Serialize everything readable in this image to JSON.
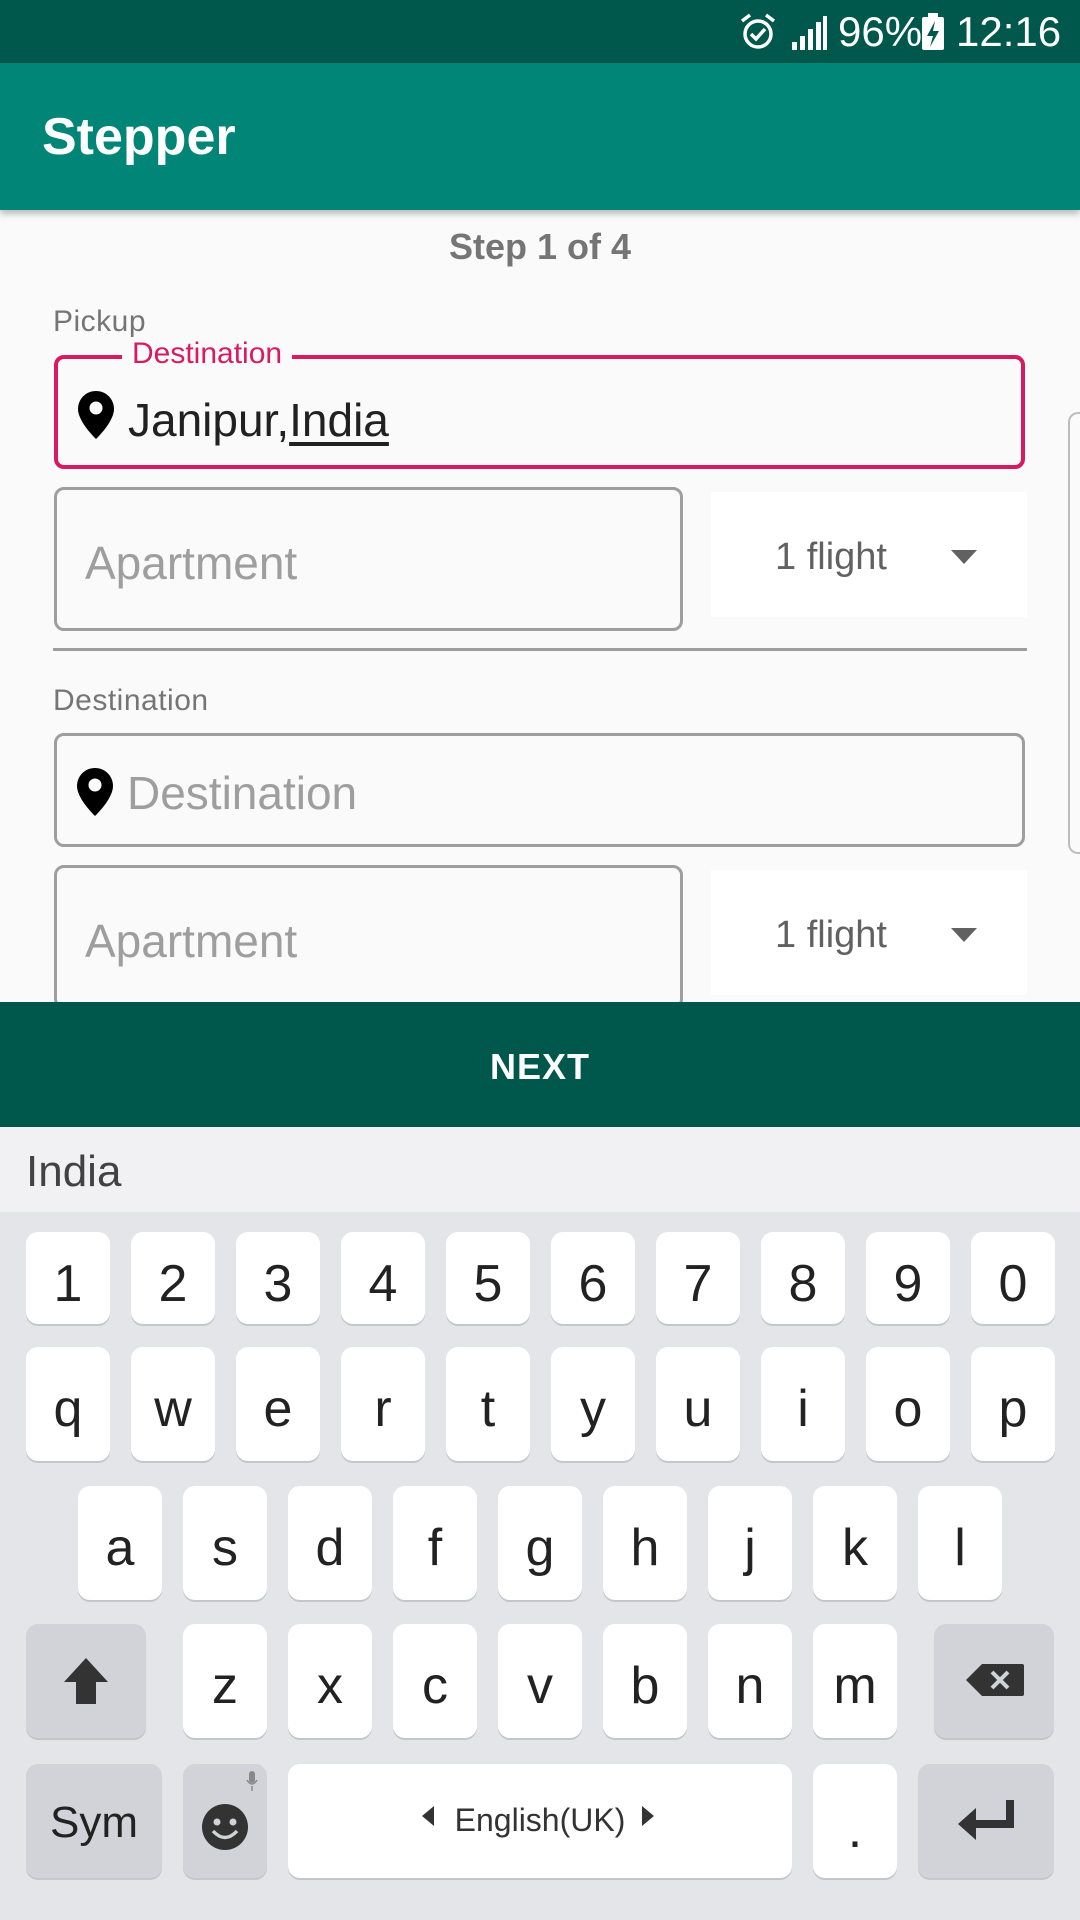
{
  "status_bar": {
    "battery": "96%",
    "time": "12:16"
  },
  "app_bar": {
    "title": "Stepper"
  },
  "step": {
    "title": "Step 1 of 4"
  },
  "pickup": {
    "section_label": "Pickup",
    "destination_label": "Destination",
    "destination_value_part1": "Janipur,",
    "destination_value_part2": "India",
    "apartment_placeholder": "Apartment",
    "flight_value": "1 flight"
  },
  "destination": {
    "section_label": "Destination",
    "destination_placeholder": "Destination",
    "apartment_placeholder": "Apartment",
    "flight_value": "1 flight"
  },
  "next_button": {
    "label": "NEXT"
  },
  "keyboard": {
    "suggestion": "India",
    "row_numbers": [
      "1",
      "2",
      "3",
      "4",
      "5",
      "6",
      "7",
      "8",
      "9",
      "0"
    ],
    "row_top": [
      "q",
      "w",
      "e",
      "r",
      "t",
      "y",
      "u",
      "i",
      "o",
      "p"
    ],
    "row_middle": [
      "a",
      "s",
      "d",
      "f",
      "g",
      "h",
      "j",
      "k",
      "l"
    ],
    "row_bottom": [
      "z",
      "x",
      "c",
      "v",
      "b",
      "n",
      "m"
    ],
    "sym_label": "Sym",
    "space_label": "English(UK)",
    "period_label": "."
  }
}
